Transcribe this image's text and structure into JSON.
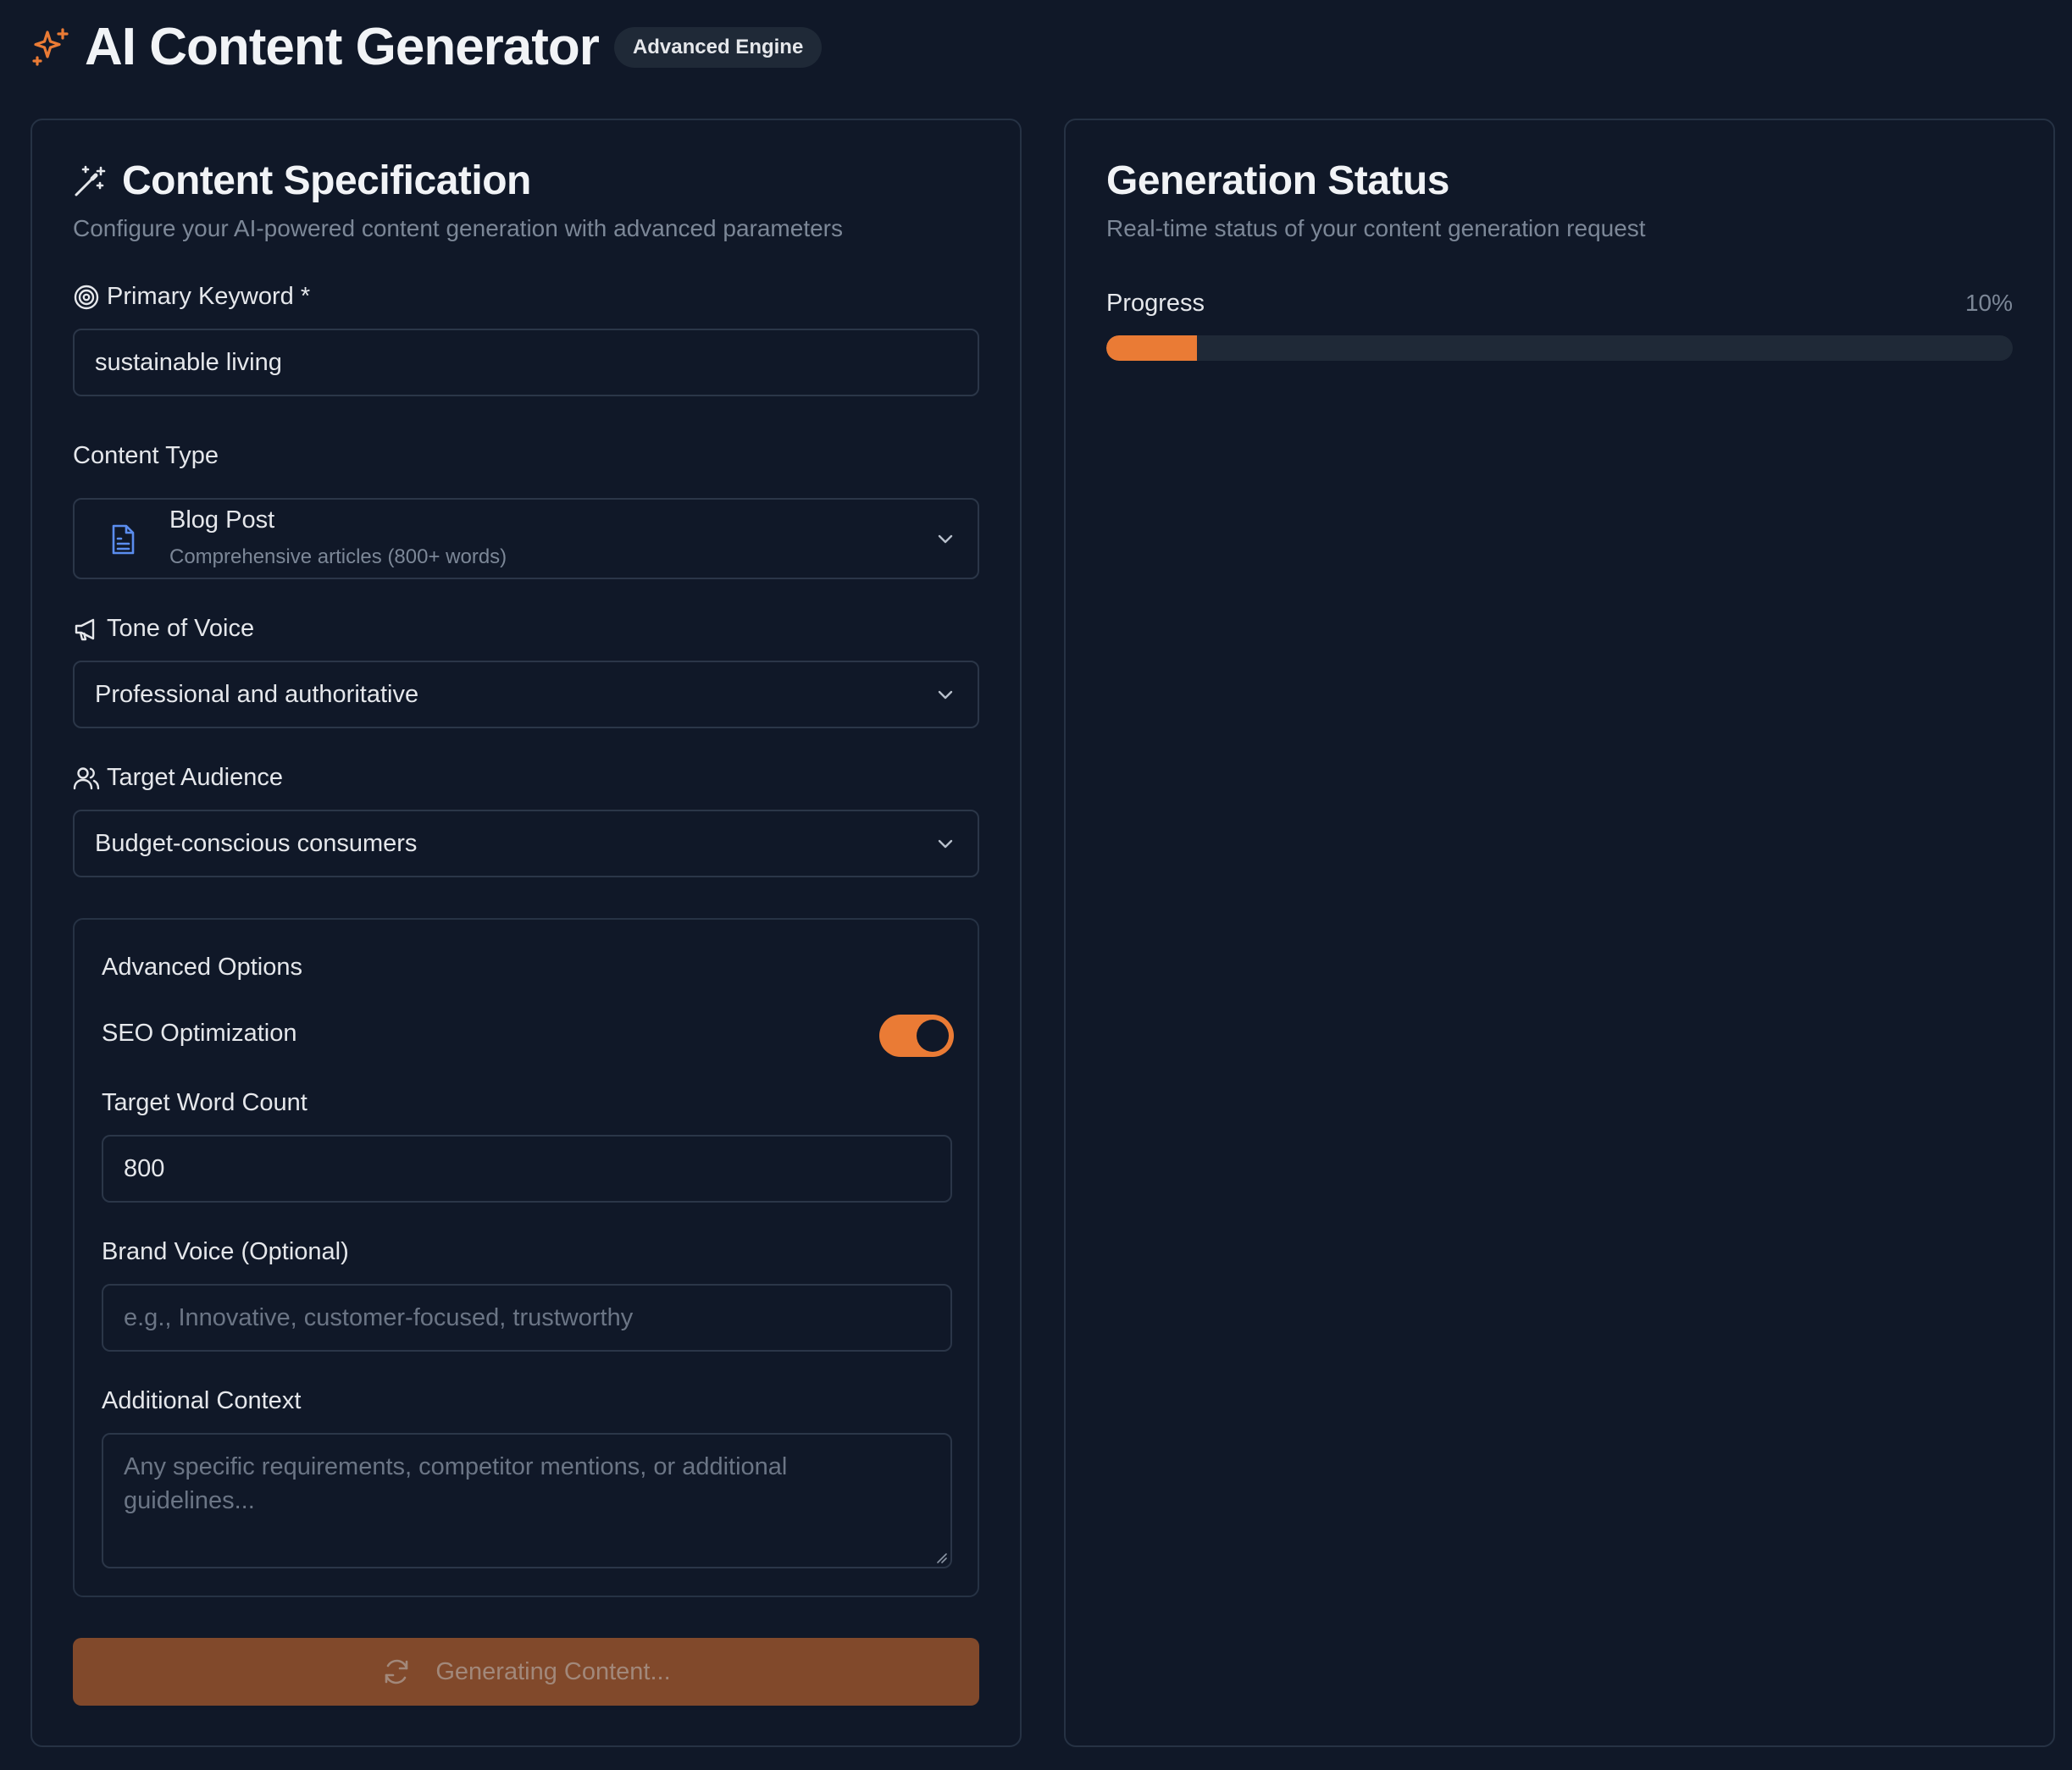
{
  "app": {
    "title": "AI Content Generator",
    "badge": "Advanced Engine",
    "logo_icon": "sparkles-icon",
    "accent_color": "#ea7b35",
    "background_color": "#101828"
  },
  "spec": {
    "title": "Content Specification",
    "title_icon": "magic-wand-icon",
    "description": "Configure your AI-powered content generation with advanced parameters",
    "keyword": {
      "label": "Primary Keyword *",
      "icon": "target-icon",
      "value": "sustainable living"
    },
    "content_type": {
      "label": "Content Type",
      "icon": "document-icon",
      "selected_title": "Blog Post",
      "selected_subtitle": "Comprehensive articles (800+ words)"
    },
    "tone": {
      "label": "Tone of Voice",
      "icon": "megaphone-icon",
      "value": "Professional and authoritative"
    },
    "audience": {
      "label": "Target Audience",
      "icon": "users-icon",
      "value": "Budget-conscious consumers"
    },
    "advanced": {
      "heading": "Advanced Options",
      "seo_label": "SEO Optimization",
      "seo_enabled": true,
      "word_count_label": "Target Word Count",
      "word_count_value": "800",
      "brand_voice_label": "Brand Voice (Optional)",
      "brand_voice_placeholder": "e.g., Innovative, customer-focused, trustworthy",
      "context_label": "Additional Context",
      "context_placeholder": "Any specific requirements, competitor mentions, or additional guidelines..."
    },
    "generate_button": {
      "label": "Generating Content...",
      "icon": "refresh-icon"
    }
  },
  "status": {
    "title": "Generation Status",
    "description": "Real-time status of your content generation request",
    "progress_label": "Progress",
    "progress_text": "10%",
    "progress_value": 0.1
  }
}
